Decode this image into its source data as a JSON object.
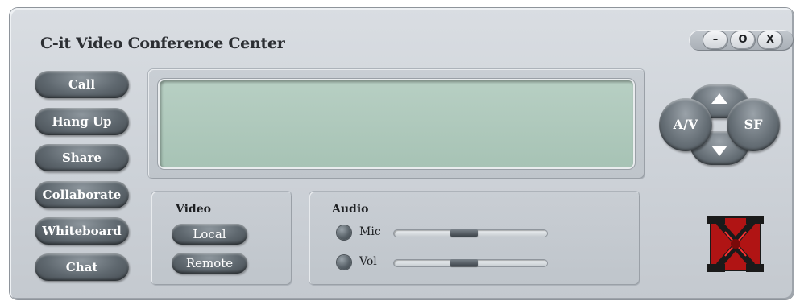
{
  "window": {
    "title": "C-it Video Conference Center",
    "controls": {
      "minimize_label": "–",
      "maximize_label": "O",
      "close_label": "X"
    }
  },
  "sidebar": {
    "buttons": [
      {
        "label": "Call"
      },
      {
        "label": "Hang Up"
      },
      {
        "label": "Share"
      },
      {
        "label": "Collaborate"
      },
      {
        "label": "Whiteboard"
      },
      {
        "label": "Chat"
      }
    ]
  },
  "display": {
    "text": ""
  },
  "video": {
    "heading": "Video",
    "local_label": "Local",
    "remote_label": "Remote"
  },
  "audio": {
    "heading": "Audio",
    "mic_label": "Mic",
    "vol_label": "Vol",
    "mic_level": 0.45,
    "vol_level": 0.45
  },
  "nav_pad": {
    "left_label": "A/V",
    "right_label": "SF",
    "up_icon": "up-arrow-icon",
    "down_icon": "down-arrow-icon"
  },
  "logo": {
    "icon": "x-logo-icon",
    "color": "#c01818"
  },
  "colors": {
    "lcd": "#a9c4b6",
    "chrome": "#cdd2d8",
    "button": "#5f686f"
  }
}
